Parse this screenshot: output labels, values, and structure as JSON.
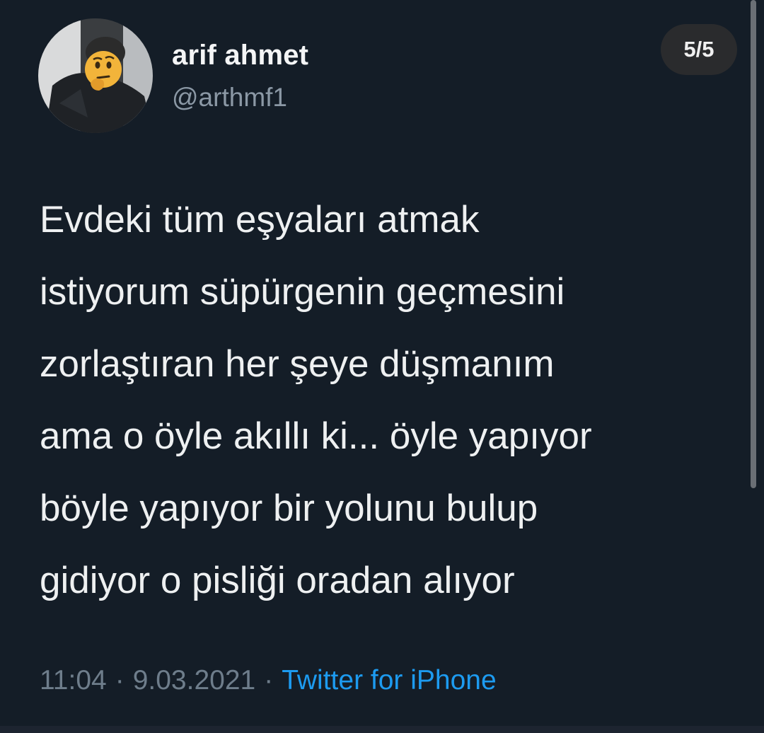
{
  "user": {
    "display_name": "arif ahmet",
    "handle": "@arthmf1",
    "avatar_overlay_emoji": "thinking-face-emoji"
  },
  "thread": {
    "counter": "5/5"
  },
  "tweet": {
    "lines": [
      "Evdeki tüm eşyaları atmak",
      "istiyorum süpürgenin geçmesini",
      "zorlaştıran her şeye düşmanım",
      "ama o öyle akıllı ki... öyle yapıyor",
      "böyle yapıyor bir yolunu bulup",
      "gidiyor o pisliği oradan alıyor"
    ]
  },
  "meta": {
    "time": "11:04",
    "separator": "·",
    "date": "9.03.2021",
    "source": "Twitter for iPhone"
  },
  "colors": {
    "background": "#141d27",
    "link": "#1d9bf0",
    "secondary_text": "#8b98a5"
  }
}
